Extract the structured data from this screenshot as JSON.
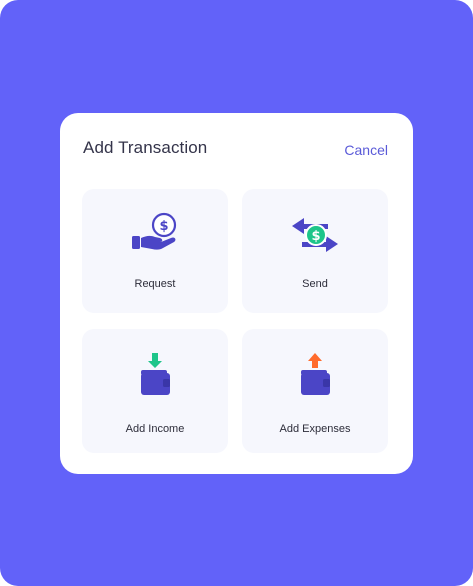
{
  "modal": {
    "title": "Add Transaction",
    "cancel_label": "Cancel"
  },
  "options": [
    {
      "label": "Request",
      "icon": "request-money-icon"
    },
    {
      "label": "Send",
      "icon": "send-money-icon"
    },
    {
      "label": "Add Income",
      "icon": "add-income-icon"
    },
    {
      "label": "Add Expenses",
      "icon": "add-expenses-icon"
    }
  ],
  "colors": {
    "background": "#6262f9",
    "primary": "#4b45c6",
    "income_green": "#1ec58a",
    "expense_orange": "#ff6b2c",
    "card_bg": "#f6f7fd"
  }
}
